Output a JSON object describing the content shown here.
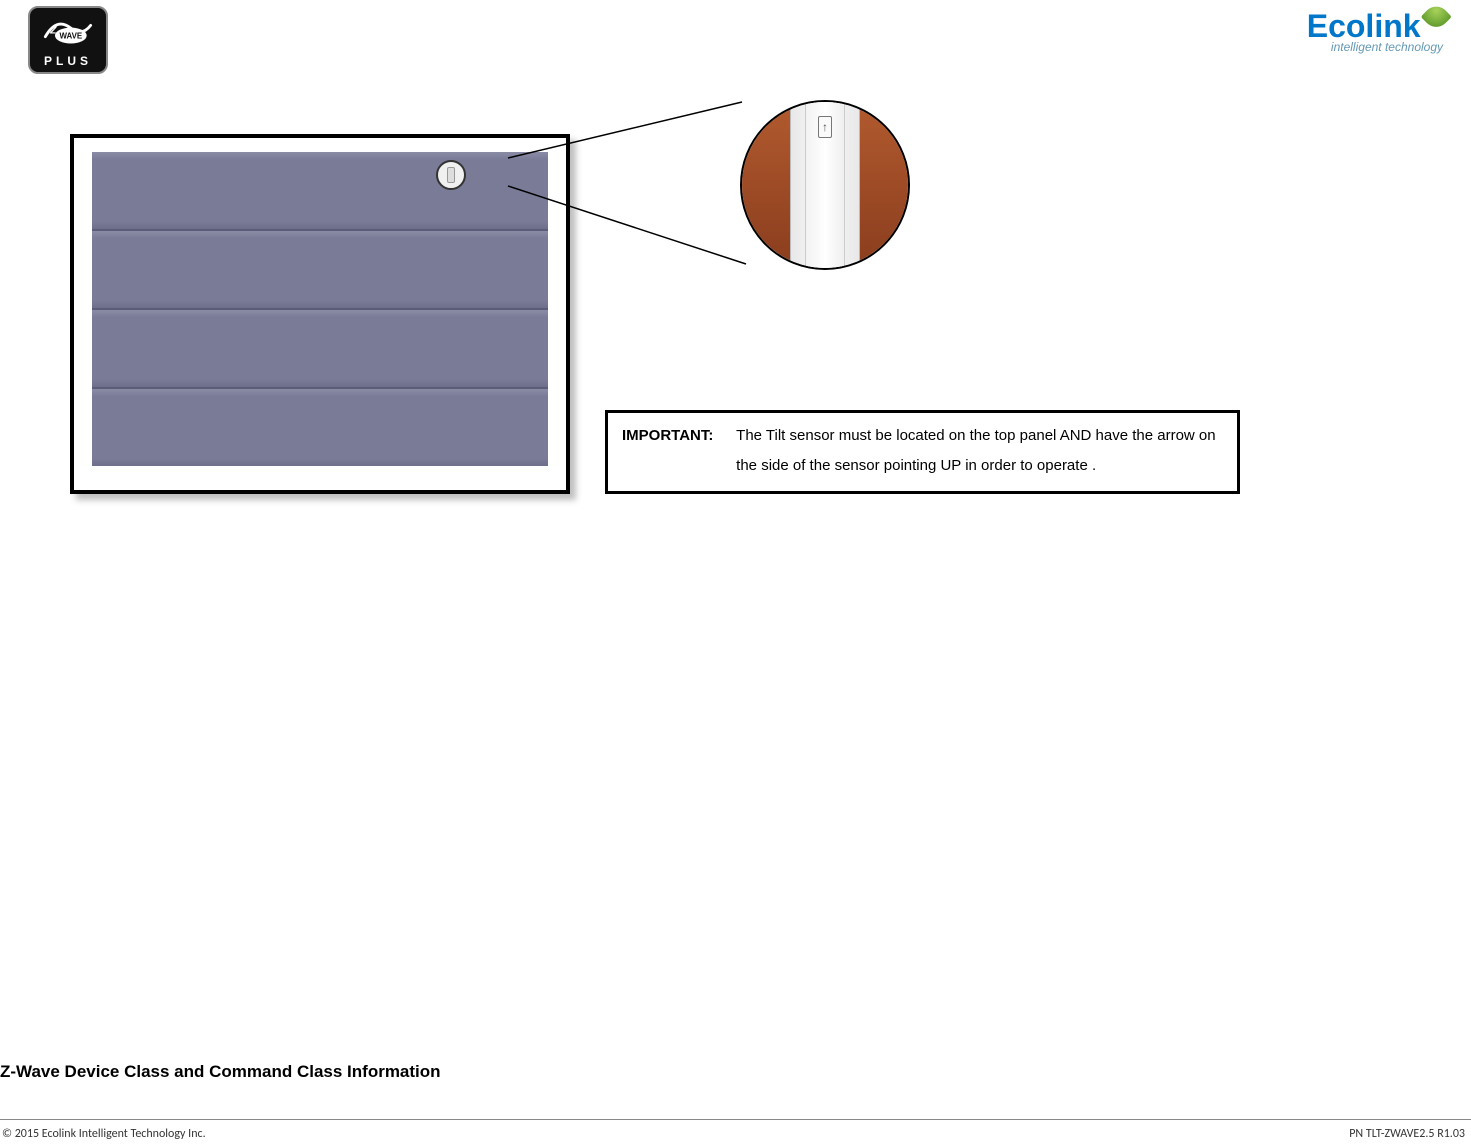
{
  "header": {
    "zwave_plus_label": "PLUS",
    "ecolink_name": "Ecolink",
    "ecolink_tagline": "intelligent technology"
  },
  "zoom": {
    "arrow_glyph": "↑"
  },
  "important": {
    "label": "IMPORTANT:",
    "text": "The Tilt sensor must be located on the top panel AND have the arrow on the side of the sensor pointing UP in order to operate ."
  },
  "section_heading": "Z-Wave Device Class and Command Class Information",
  "footer": {
    "copyright": "© 2015 Ecolink Intelligent Technology Inc.",
    "part_number": "PN TLT-ZWAVE2.5  R1.03"
  }
}
